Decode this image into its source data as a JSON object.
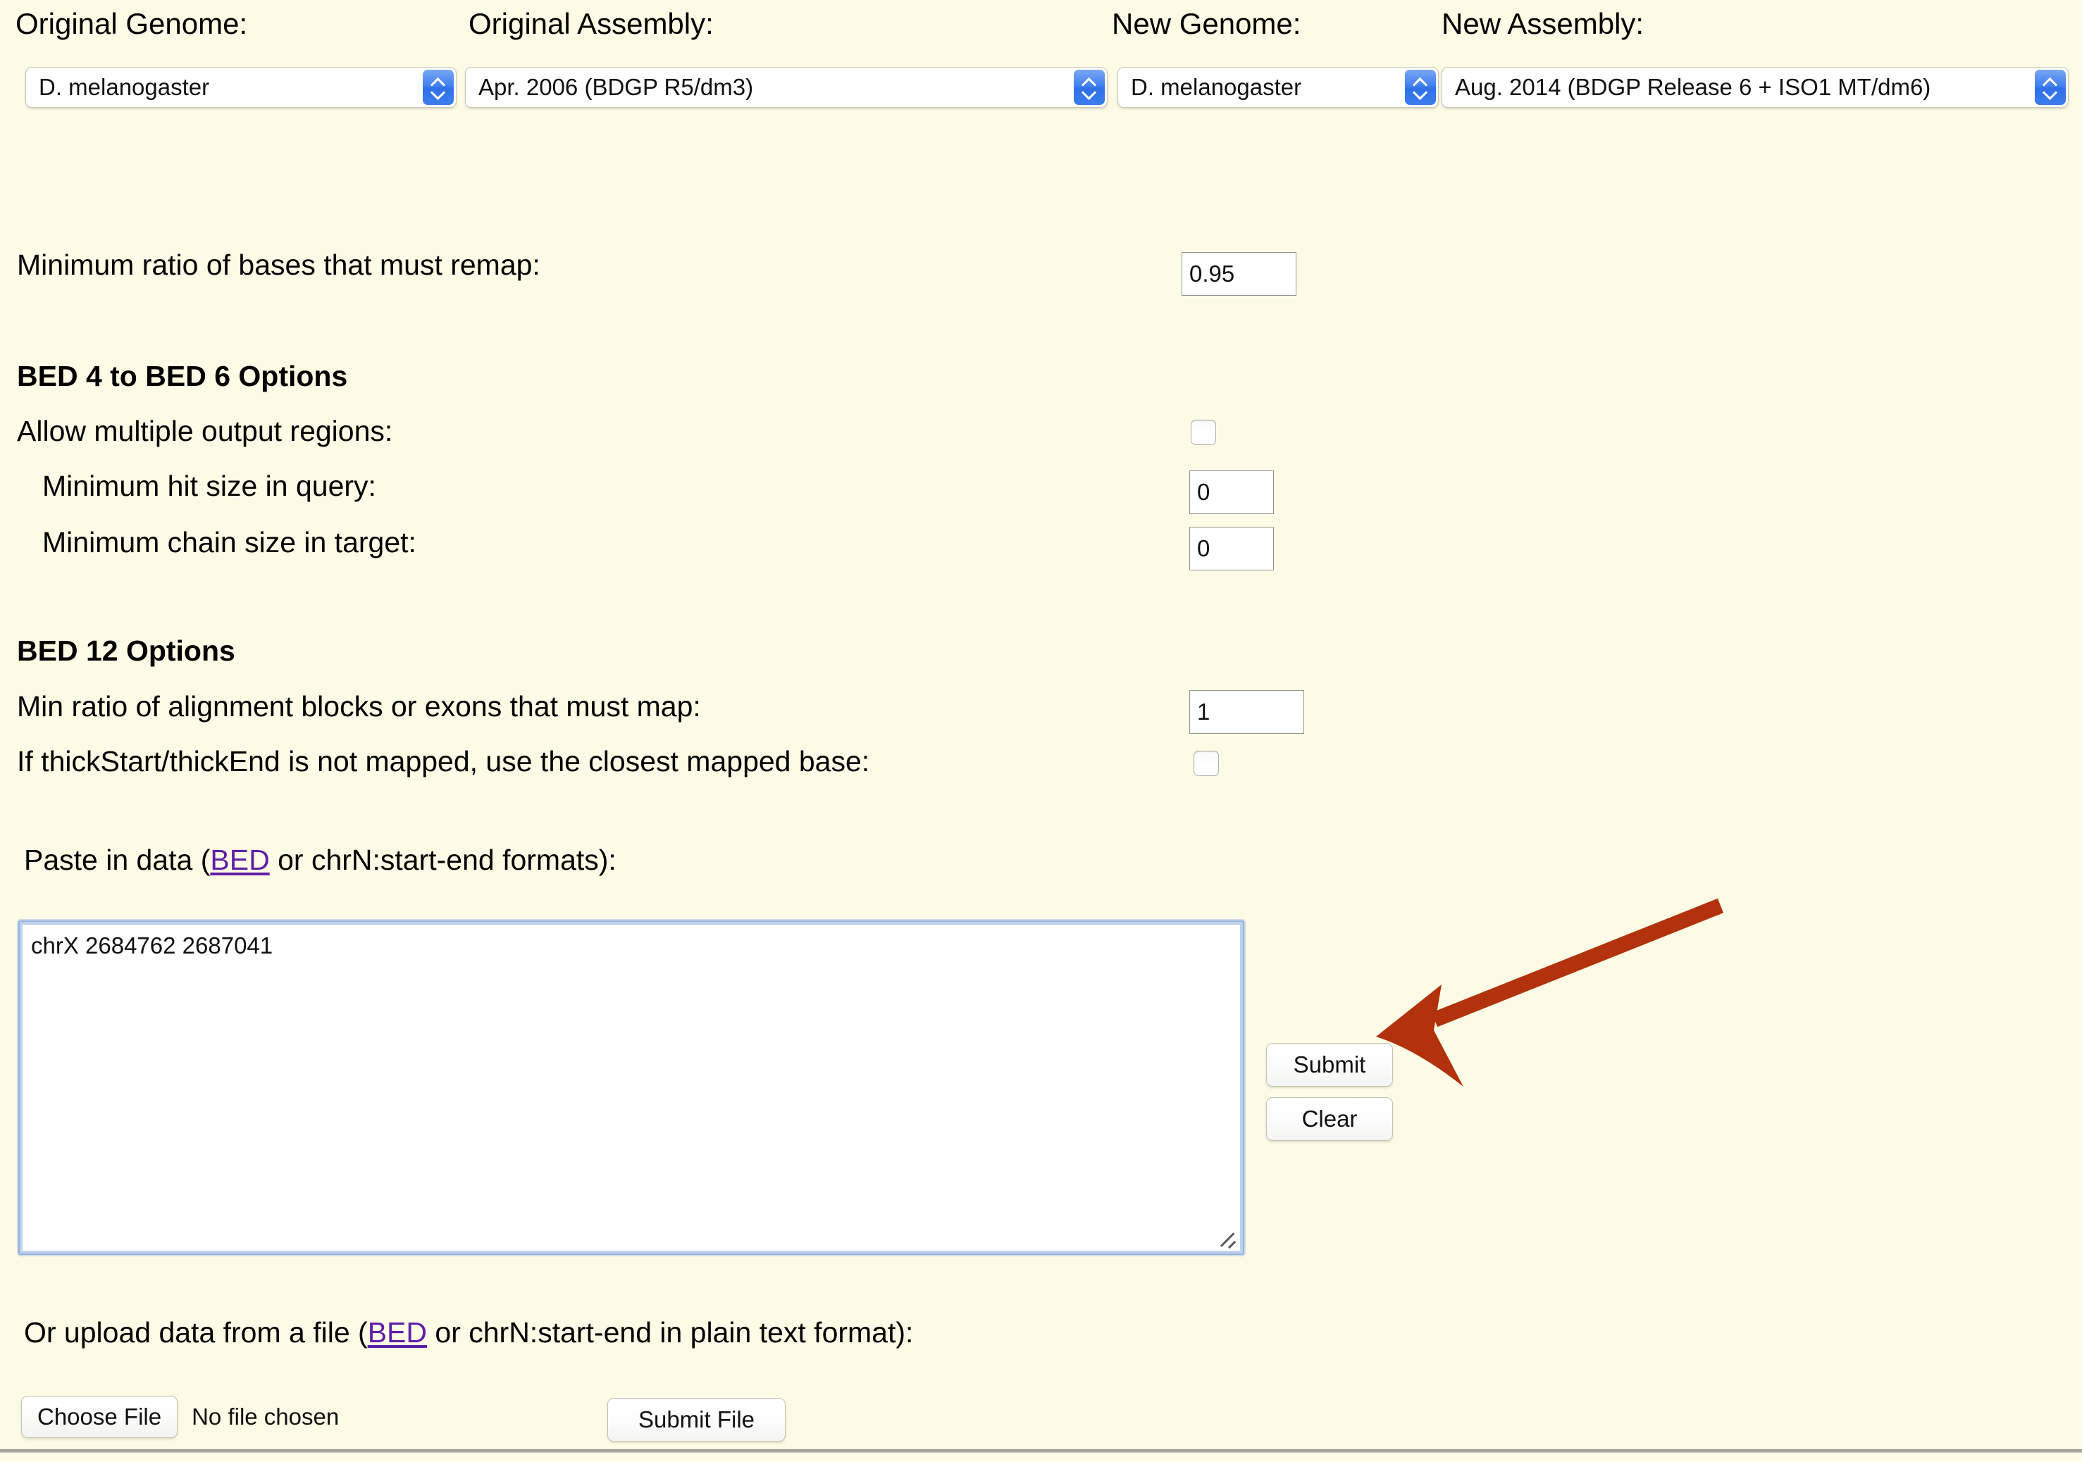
{
  "header": {
    "fields": [
      {
        "label": "Original Genome:",
        "value": "D. melanogaster"
      },
      {
        "label": "Original Assembly:",
        "value": "Apr. 2006 (BDGP R5/dm3)"
      },
      {
        "label": "New Genome:",
        "value": "D. melanogaster"
      },
      {
        "label": "New Assembly:",
        "value": "Aug. 2014 (BDGP Release 6 + ISO1 MT/dm6)"
      }
    ]
  },
  "min_ratio": {
    "label": "Minimum ratio of bases that must remap:",
    "value": "0.95"
  },
  "bed4to6": {
    "title": "BED 4 to BED 6 Options",
    "allow_multiple_label": "Allow multiple output regions:",
    "allow_multiple_checked": false,
    "min_hit_label": "Minimum hit size in query:",
    "min_hit_value": "0",
    "min_chain_label": "Minimum chain size in target:",
    "min_chain_value": "0"
  },
  "bed12": {
    "title": "BED 12 Options",
    "min_ratio_blocks_label": "Min ratio of alignment blocks or exons that must map:",
    "min_ratio_blocks_value": "1",
    "thick_label": "If thickStart/thickEnd is not mapped, use the closest mapped base:",
    "thick_checked": false
  },
  "paste": {
    "prefix": "Paste in data (",
    "link": "BED",
    "suffix": " or chrN:start-end formats):",
    "value": "chrX 2684762 2687041",
    "submit_label": "Submit",
    "clear_label": "Clear"
  },
  "upload": {
    "prefix": "Or upload data from a file (",
    "link": "BED",
    "suffix": " or chrN:start-end in plain text format):",
    "choose_label": "Choose File",
    "no_file_label": "No file chosen",
    "submit_file_label": "Submit File"
  },
  "annotation": {
    "arrow_color": "#b1320c",
    "arrow_target": "Submit"
  },
  "colors": {
    "page_background": "#fdfbe5",
    "link": "#5f1fa8",
    "select_button": "#3d7ef0",
    "focus_border": "#9ab3dd"
  }
}
